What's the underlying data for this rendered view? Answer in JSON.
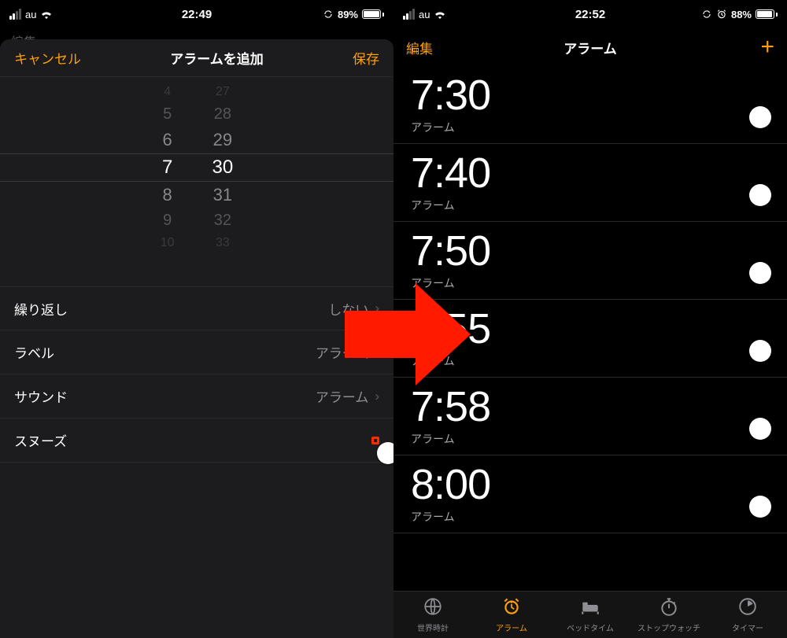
{
  "left": {
    "status": {
      "carrier": "au",
      "time": "22:49",
      "battery_pct": "89%",
      "battery_fill": 89,
      "show_alarm_icon": false
    },
    "backdrop_edit": "編集",
    "sheet": {
      "cancel": "キャンセル",
      "title": "アラームを追加",
      "save": "保存"
    },
    "picker": {
      "hours": [
        "4",
        "5",
        "6",
        "7",
        "8",
        "9",
        "10"
      ],
      "minutes": [
        "27",
        "28",
        "29",
        "30",
        "31",
        "32",
        "33"
      ],
      "selected_hour": "7",
      "selected_minute": "30"
    },
    "rows": {
      "repeat": {
        "label": "繰り返し",
        "value": "しない"
      },
      "label": {
        "label": "ラベル",
        "value": "アラーム"
      },
      "sound": {
        "label": "サウンド",
        "value": "アラーム"
      },
      "snooze": {
        "label": "スヌーズ",
        "on": false
      }
    }
  },
  "right": {
    "status": {
      "carrier": "au",
      "time": "22:52",
      "battery_pct": "88%",
      "battery_fill": 88,
      "show_alarm_icon": true
    },
    "nav": {
      "edit": "編集",
      "title": "アラーム",
      "add": "+"
    },
    "alarms": [
      {
        "time": "7:30",
        "sub": "アラーム",
        "on": true
      },
      {
        "time": "7:40",
        "sub": "アラーム",
        "on": true
      },
      {
        "time": "7:50",
        "sub": "アラーム",
        "on": true
      },
      {
        "time": "7:55",
        "sub": "アラーム",
        "on": true
      },
      {
        "time": "7:58",
        "sub": "アラーム",
        "on": true
      },
      {
        "time": "8:00",
        "sub": "アラーム",
        "on": true
      }
    ],
    "tabs": [
      {
        "id": "world",
        "label": "世界時計"
      },
      {
        "id": "alarm",
        "label": "アラーム"
      },
      {
        "id": "bedtime",
        "label": "ベッドタイム"
      },
      {
        "id": "stopwatch",
        "label": "ストップウォッチ"
      },
      {
        "id": "timer",
        "label": "タイマー"
      }
    ],
    "active_tab": "alarm"
  }
}
